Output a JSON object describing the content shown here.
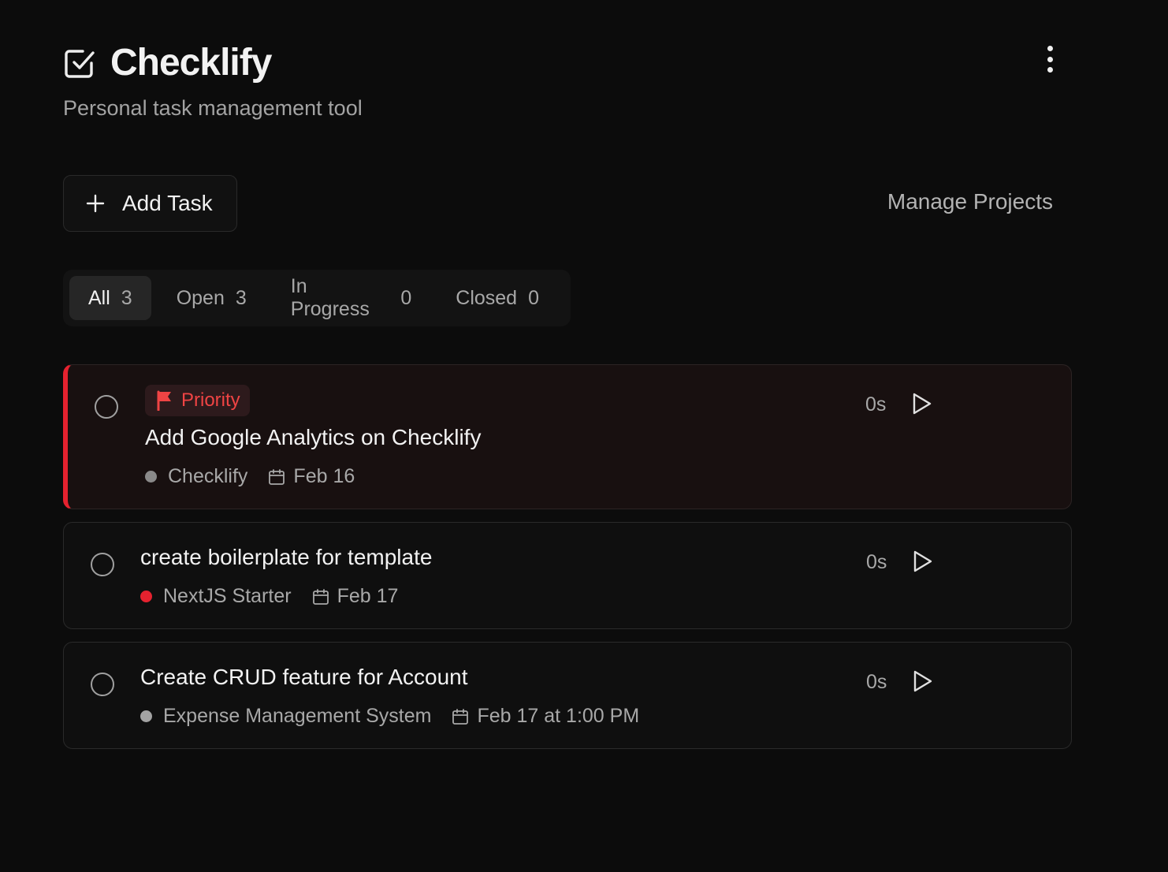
{
  "app": {
    "title": "Checklify",
    "subtitle": "Personal task management tool",
    "icons": {
      "logo": "checkbox-square-icon",
      "menu": "more-vertical-icon"
    }
  },
  "toolbar": {
    "add_task_label": "Add Task",
    "manage_projects_label": "Manage Projects"
  },
  "tabs": [
    {
      "label": "All",
      "count": "3",
      "active": true
    },
    {
      "label": "Open",
      "count": "3",
      "active": false
    },
    {
      "label": "In Progress",
      "count": "0",
      "active": false
    },
    {
      "label": "Closed",
      "count": "0",
      "active": false
    }
  ],
  "tasks": [
    {
      "badge": "Priority",
      "title": "Add Google Analytics on Checklify",
      "project": "Checklify",
      "project_color": "#8a8a8a",
      "date": "Feb 16",
      "elapsed": "0s"
    },
    {
      "title": "create boilerplate for template",
      "project": "NextJS Starter",
      "project_color": "#e5222f",
      "date": "Feb 17",
      "elapsed": "0s"
    },
    {
      "title": "Create CRUD feature for Account",
      "project": "Expense Management System",
      "project_color": "#a3a3a3",
      "date": "Feb 17 at 1:00 PM",
      "elapsed": "0s"
    }
  ],
  "colors": {
    "priority_accent": "#e5222f",
    "background": "#0c0c0c"
  }
}
